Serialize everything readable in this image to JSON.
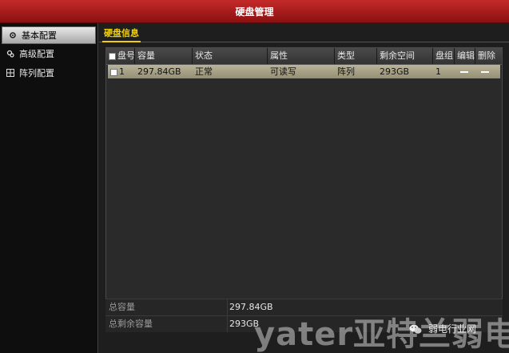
{
  "window": {
    "title": "硬盘管理"
  },
  "sidebar": {
    "items": [
      {
        "label": "基本配置",
        "icon": "gear-icon",
        "active": true
      },
      {
        "label": "高级配置",
        "icon": "gears-icon",
        "active": false
      },
      {
        "label": "阵列配置",
        "icon": "grid-icon",
        "active": false
      }
    ]
  },
  "tabs": [
    {
      "label": "硬盘信息"
    }
  ],
  "table": {
    "columns": [
      "盘号",
      "容量",
      "状态",
      "属性",
      "类型",
      "剩余空间",
      "盘组",
      "编辑",
      "删除"
    ],
    "rows": [
      {
        "disk_no": "1",
        "capacity": "297.84GB",
        "status": "正常",
        "attribute": "可读写",
        "type": "阵列",
        "free": "293GB",
        "group": "1"
      }
    ]
  },
  "summary": {
    "total_label": "总容量",
    "total_value": "297.84GB",
    "free_label": "总剩余容量",
    "free_value": "293GB"
  },
  "watermark": {
    "big": "yater亚特兰弱电",
    "small": "弱电行业网"
  },
  "colors": {
    "titlebar": "#b01c1c",
    "tab_accent": "#f2d000",
    "selected_row": "#b0ab8f"
  }
}
